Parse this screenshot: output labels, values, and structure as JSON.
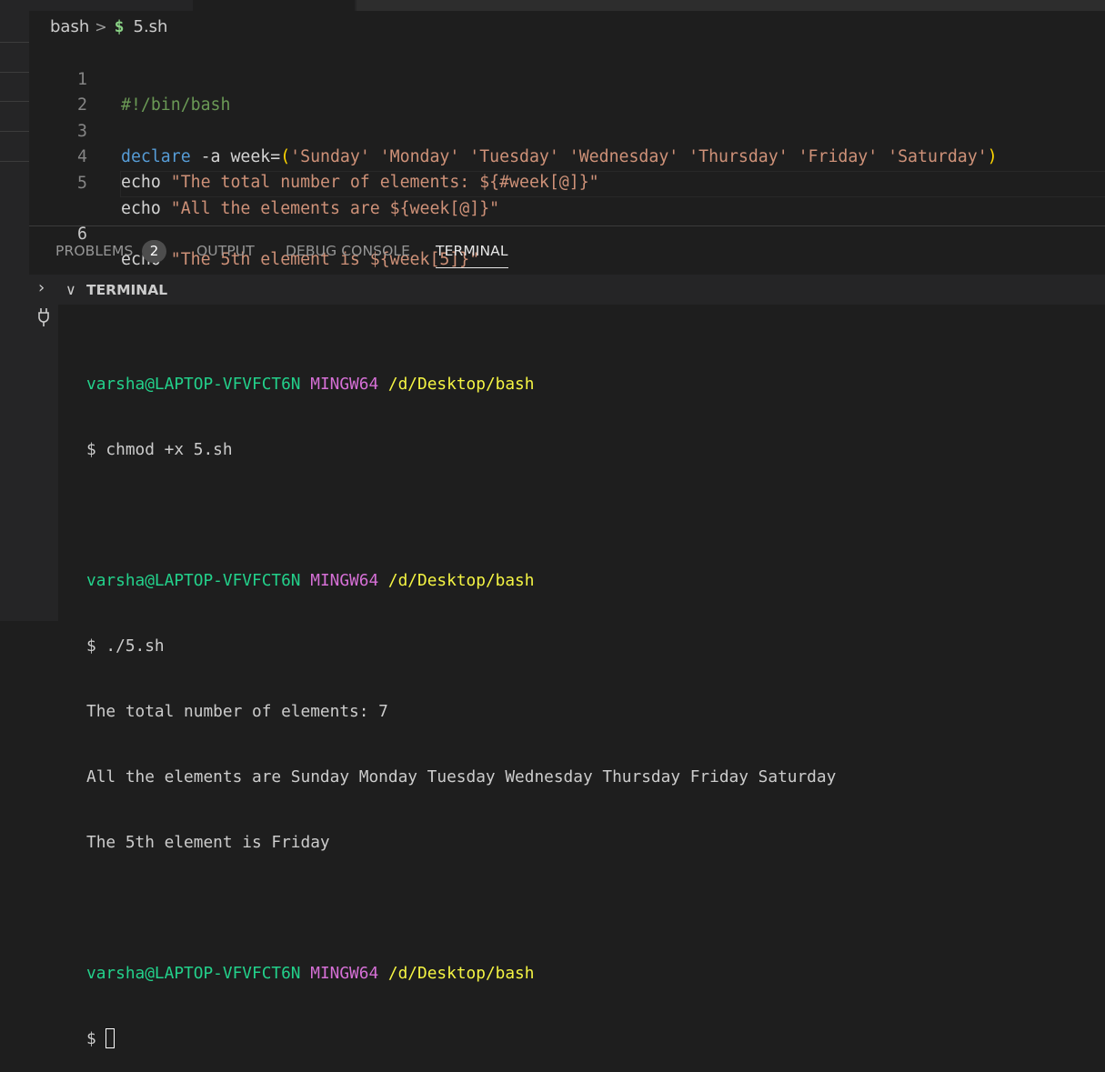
{
  "breadcrumb": {
    "folder": "bash",
    "separator": ">",
    "file_icon": "$",
    "file": "5.sh"
  },
  "editor": {
    "lines": [
      {
        "num": "1",
        "comment": "#!/bin/bash"
      },
      {
        "num": "2"
      },
      {
        "num": "3",
        "kw": "declare",
        "flag": " -a week=",
        "p1": "(",
        "items": "'Sunday' 'Monday' 'Tuesday' 'Wednesday' 'Thursday' 'Friday' 'Saturday'",
        "p2": ")"
      },
      {
        "num": "4",
        "cmd": "echo",
        "str": " \"The total number of elements: ${#week[@]}\""
      },
      {
        "num": "5",
        "cmd": "echo",
        "str": " \"All the elements are ${week[@]}\""
      },
      {
        "num": "6",
        "cmd": "echo",
        "str": " \"The 5th element is ${week[5]}\""
      }
    ]
  },
  "panel": {
    "tabs": {
      "problems": "PROBLEMS",
      "problems_count": "2",
      "output": "OUTPUT",
      "debug": "DEBUG CONSOLE",
      "terminal": "TERMINAL"
    },
    "terminal_header": "TERMINAL",
    "prompt": {
      "user": "varsha@LAPTOP-VFVFCT6N",
      "env": "MINGW64",
      "path": "/d/Desktop/bash"
    },
    "lines": {
      "cmd1": "$ chmod +x 5.sh",
      "cmd2": "$ ./5.sh",
      "out1": "The total number of elements: 7",
      "out2": "All the elements are Sunday Monday Tuesday Wednesday Thursday Friday Saturday",
      "out3": "The 5th element is Friday",
      "cmd3": "$ "
    }
  }
}
